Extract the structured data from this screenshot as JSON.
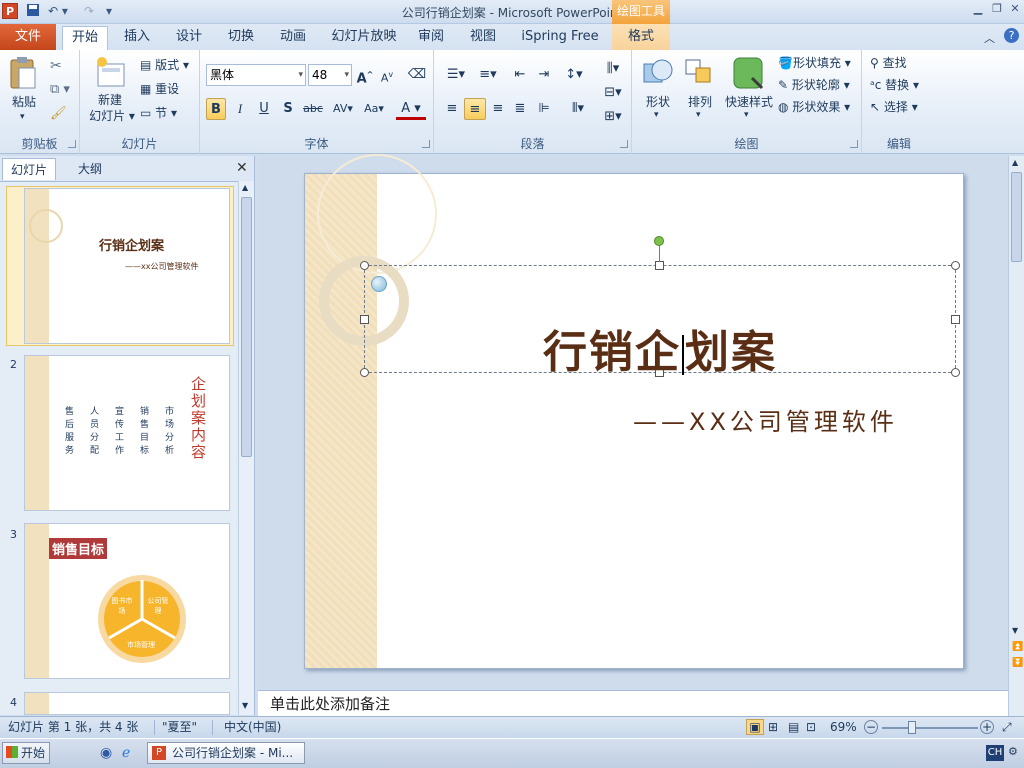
{
  "window": {
    "title": "公司行销企划案 - Microsoft PowerPoint",
    "app_icon": "P",
    "context_tab_group": "绘图工具"
  },
  "tabs": {
    "file": "文件",
    "items": [
      "开始",
      "插入",
      "设计",
      "切换",
      "动画",
      "幻灯片放映",
      "审阅",
      "视图",
      "iSpring Free",
      "格式"
    ],
    "active": "开始"
  },
  "ribbon": {
    "clipboard": {
      "label": "剪贴板",
      "paste": "粘贴"
    },
    "slides": {
      "label": "幻灯片",
      "new_slide": "新建",
      "new_slide2": "幻灯片",
      "layout": "版式",
      "reset": "重设",
      "section": "节"
    },
    "font": {
      "label": "字体",
      "font_name": "黑体",
      "font_size": "48",
      "bold": "B",
      "italic": "I",
      "underline": "U",
      "shadow": "S",
      "strike": "abc",
      "spacing": "AV",
      "case": "Aa",
      "color": "A",
      "grow": "A",
      "shrink": "A"
    },
    "paragraph": {
      "label": "段落"
    },
    "drawing": {
      "label": "绘图",
      "shape": "形状",
      "arrange": "排列",
      "quick_style": "快速样式",
      "fill": "形状填充",
      "outline": "形状轮廓",
      "effect": "形状效果"
    },
    "editing": {
      "label": "编辑",
      "find": "查找",
      "replace": "替换",
      "select": "选择"
    }
  },
  "left_panel": {
    "tab_slides": "幻灯片",
    "tab_outline": "大纲",
    "thumbs": [
      {
        "num": "1",
        "title": "行销企划案",
        "subtitle": "——xx公司管理软件"
      },
      {
        "num": "2",
        "vtitle": "企划案内容",
        "columns": [
          "市场分析",
          "销售目标",
          "宣传工作",
          "人员分配",
          "售后服务"
        ]
      },
      {
        "num": "3",
        "title": "销售目标",
        "seg1": "图书市场",
        "seg2": "公司管理",
        "seg3": "市场管理"
      },
      {
        "num": "4"
      }
    ]
  },
  "slide": {
    "title_before_cursor": "行销企",
    "title_after_cursor": "划案",
    "subtitle": "——XX公司管理软件"
  },
  "notes_placeholder": "单击此处添加备注",
  "status": {
    "slide_info": "幻灯片 第 1 张，共 4 张",
    "theme": "\"夏至\"",
    "language": "中文(中国)",
    "zoom": "69%"
  },
  "taskbar": {
    "start": "开始",
    "item": "公司行销企划案 - Mi...",
    "ime": "CH"
  },
  "colors": {
    "accent_file": "#c5461b",
    "title_brown": "#5a2e14",
    "thumb_red": "#c0392b",
    "chart_orange": "#f7b52c"
  }
}
